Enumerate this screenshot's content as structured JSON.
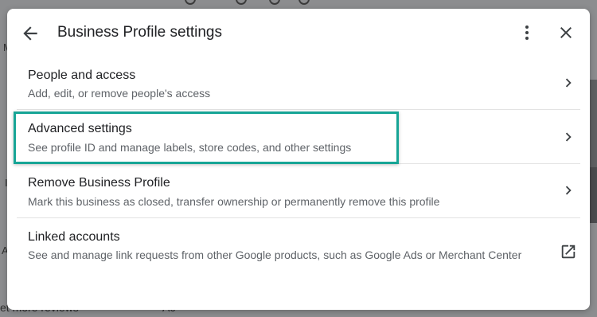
{
  "background": {
    "left_letter_1": "M",
    "left_letter_2": "I",
    "left_letter_3": "A",
    "bottom_left_text": "et more reviews",
    "bottom_mid_text": "Ac"
  },
  "dialog": {
    "title": "Business Profile settings",
    "back_icon": "arrow-back-icon",
    "more_icon": "more-vert-icon",
    "close_icon": "close-icon"
  },
  "rows": [
    {
      "title": "People and access",
      "subtitle": "Add, edit, or remove people's access",
      "icon": "chevron-right-icon"
    },
    {
      "title": "Advanced settings",
      "subtitle": "See profile ID and manage labels, store codes, and other settings",
      "icon": "chevron-right-icon"
    },
    {
      "title": "Remove Business Profile",
      "subtitle": "Mark this business as closed, transfer ownership or permanently remove this profile",
      "icon": "chevron-right-icon"
    },
    {
      "title": "Linked accounts",
      "subtitle": "See and manage link requests from other Google products, such as Google Ads or Merchant Center",
      "icon": "open-in-new-icon"
    }
  ],
  "colors": {
    "highlight": "#17a596",
    "overlay": "#8c8d8f",
    "text_primary": "#202124",
    "text_secondary": "#5f6368"
  }
}
